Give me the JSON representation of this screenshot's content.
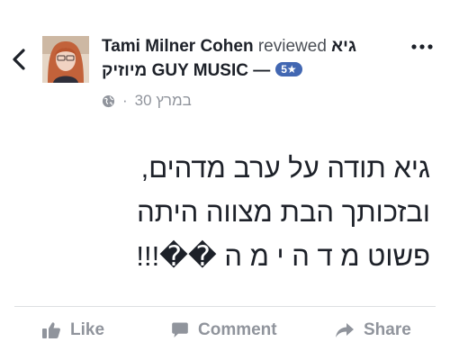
{
  "post": {
    "author": "Tami Milner Cohen",
    "verb": "reviewed",
    "page_name_part1": "גיא",
    "page_name_part2": "מיוזיק GUY MUSIC —",
    "rating": "5★",
    "date": "30 במרץ",
    "separator": "·"
  },
  "review": {
    "lines": [
      "גיא תודה על ערב מדהים,",
      "ובזכותך  הבת מצווה היתה",
      "פשוט מ ד ה י מ ה ��!!!"
    ]
  },
  "actions": {
    "like_label": "Like",
    "comment_label": "Comment",
    "share_label": "Share"
  },
  "icons": {
    "back": "chevron-left-icon",
    "more": "more-dots-icon",
    "privacy": "globe-icon",
    "like": "thumbs-up-icon",
    "comment": "comment-bubble-icon",
    "share": "share-arrow-icon"
  },
  "colors": {
    "primary_text": "#1d2129",
    "secondary_text": "#90949c",
    "badge": "#4267b2",
    "divider": "#dddfe2"
  }
}
